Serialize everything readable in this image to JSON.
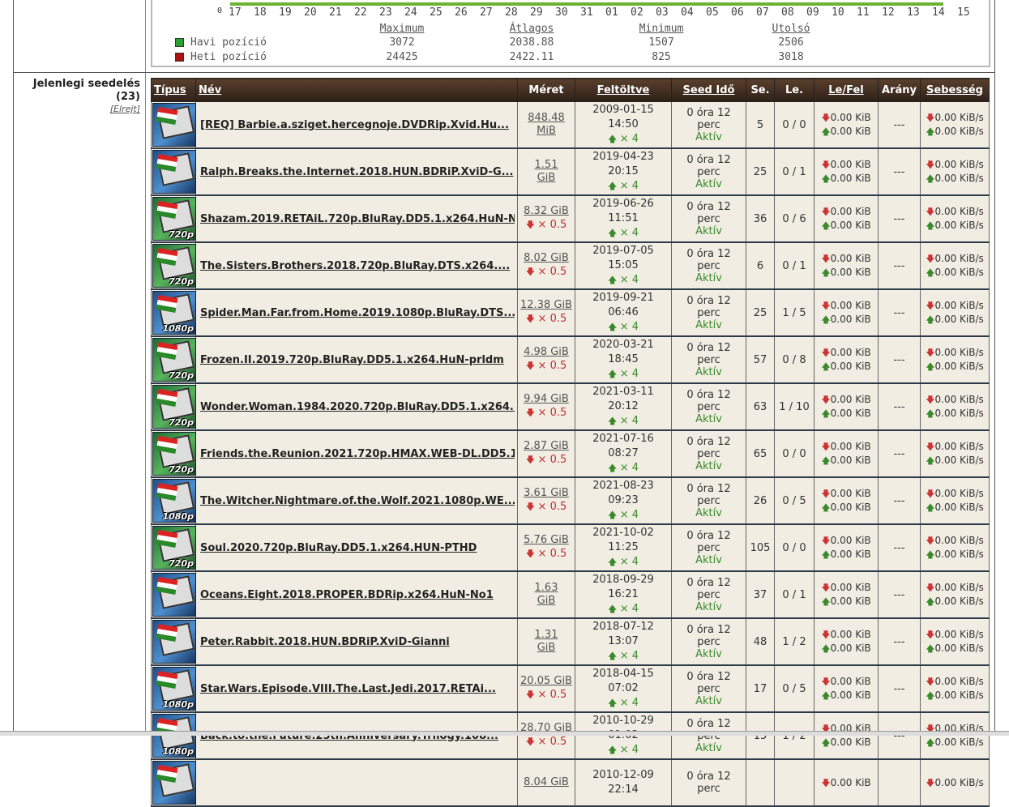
{
  "stats": {
    "axis_zero": "0",
    "axis_labels": [
      "17",
      "18",
      "19",
      "20",
      "21",
      "22",
      "23",
      "24",
      "25",
      "26",
      "27",
      "28",
      "29",
      "30",
      "31",
      "01",
      "02",
      "03",
      "04",
      "05",
      "06",
      "07",
      "08",
      "09",
      "10",
      "11",
      "12",
      "13",
      "14",
      "15"
    ],
    "headers": [
      "Maximum",
      "Átlagos",
      "Minimum",
      "Utolsó"
    ],
    "rows": [
      {
        "label": "Havi pozíció",
        "color": "#2ca02c",
        "values": [
          "3072",
          "2038.88",
          "1507",
          "2506"
        ]
      },
      {
        "label": "Heti pozíció",
        "color": "#b01010",
        "values": [
          "24425",
          "2422.11",
          "825",
          "3018"
        ]
      }
    ]
  },
  "section": {
    "title": "Jelenlegi seedelés",
    "count": "(23)",
    "hide_link": "[Elrejt]"
  },
  "table": {
    "headers": {
      "type": "Típus",
      "name": "Név",
      "size": "Méret",
      "uploaded": "Feltöltve",
      "seedtime": "Seed Idő",
      "seeders": "Se.",
      "leechers": "Le.",
      "downup": "Le/Fel",
      "ratio": "Arány",
      "speed": "Sebesség"
    },
    "rows": [
      {
        "icon": "sd",
        "res": "",
        "name": "[REQ] Barbie.a.sziget.hercegnoje.DVDRip.Xvid.Hu...",
        "size1": "848.48",
        "size2": "MiB",
        "mult": "",
        "date": "2009-01-15 14:50",
        "up_mult": "× 4",
        "seedtime": "0 óra 12 perc",
        "status": "Aktív",
        "se": "5",
        "le": "0 / 0",
        "down": "0.00 KiB",
        "up": "0.00 KiB",
        "ratio": "---",
        "sdown": "0.00 KiB/s",
        "sup": "0.00 KiB/s"
      },
      {
        "icon": "sd",
        "res": "",
        "name": "Ralph.Breaks.the.Internet.2018.HUN.BDRiP.XviD-G...",
        "size1": "1.51",
        "size2": "GiB",
        "mult": "",
        "date": "2019-04-23 20:15",
        "up_mult": "× 4",
        "seedtime": "0 óra 12 perc",
        "status": "Aktív",
        "se": "25",
        "le": "0 / 1",
        "down": "0.00 KiB",
        "up": "0.00 KiB",
        "ratio": "---",
        "sdown": "0.00 KiB/s",
        "sup": "0.00 KiB/s"
      },
      {
        "icon": "hd720",
        "res": "720p",
        "name": "Shazam.2019.RETAiL.720p.BluRay.DD5.1.x264.HuN-No1",
        "size1": "8.32 GiB",
        "size2": "",
        "mult": "× 0.5",
        "date": "2019-06-26 11:51",
        "up_mult": "× 4",
        "seedtime": "0 óra 12 perc",
        "status": "Aktív",
        "se": "36",
        "le": "0 / 6",
        "down": "0.00 KiB",
        "up": "0.00 KiB",
        "ratio": "---",
        "sdown": "0.00 KiB/s",
        "sup": "0.00 KiB/s"
      },
      {
        "icon": "hd720",
        "res": "720p",
        "name": "The.Sisters.Brothers.2018.720p.BluRay.DTS.x264....",
        "size1": "8.02 GiB",
        "size2": "",
        "mult": "× 0.5",
        "date": "2019-07-05 15:05",
        "up_mult": "× 4",
        "seedtime": "0 óra 12 perc",
        "status": "Aktív",
        "se": "6",
        "le": "0 / 1",
        "down": "0.00 KiB",
        "up": "0.00 KiB",
        "ratio": "---",
        "sdown": "0.00 KiB/s",
        "sup": "0.00 KiB/s"
      },
      {
        "icon": "hd1080",
        "res": "1080p",
        "name": "Spider.Man.Far.from.Home.2019.1080p.BluRay.DTS....",
        "size1": "12.38 GiB",
        "size2": "",
        "mult": "× 0.5",
        "date": "2019-09-21 06:46",
        "up_mult": "× 4",
        "seedtime": "0 óra 12 perc",
        "status": "Aktív",
        "se": "25",
        "le": "1 / 5",
        "down": "0.00 KiB",
        "up": "0.00 KiB",
        "ratio": "---",
        "sdown": "0.00 KiB/s",
        "sup": "0.00 KiB/s"
      },
      {
        "icon": "hd720",
        "res": "720p",
        "name": "Frozen.II.2019.720p.BluRay.DD5.1.x264.HuN-prldm",
        "size1": "4.98 GiB",
        "size2": "",
        "mult": "× 0.5",
        "date": "2020-03-21 18:45",
        "up_mult": "× 4",
        "seedtime": "0 óra 12 perc",
        "status": "Aktív",
        "se": "57",
        "le": "0 / 8",
        "down": "0.00 KiB",
        "up": "0.00 KiB",
        "ratio": "---",
        "sdown": "0.00 KiB/s",
        "sup": "0.00 KiB/s"
      },
      {
        "icon": "hd720",
        "res": "720p",
        "name": "Wonder.Woman.1984.2020.720p.BluRay.DD5.1.x264.H...",
        "size1": "9.94 GiB",
        "size2": "",
        "mult": "× 0.5",
        "date": "2021-03-11 20:12",
        "up_mult": "× 4",
        "seedtime": "0 óra 12 perc",
        "status": "Aktív",
        "se": "63",
        "le": "1 / 10",
        "down": "0.00 KiB",
        "up": "0.00 KiB",
        "ratio": "---",
        "sdown": "0.00 KiB/s",
        "sup": "0.00 KiB/s"
      },
      {
        "icon": "hd720",
        "res": "720p",
        "name": "Friends.the.Reunion.2021.720p.HMAX.WEB-DL.DD5.1...",
        "size1": "2.87 GiB",
        "size2": "",
        "mult": "× 0.5",
        "date": "2021-07-16 08:27",
        "up_mult": "× 4",
        "seedtime": "0 óra 12 perc",
        "status": "Aktív",
        "se": "65",
        "le": "0 / 0",
        "down": "0.00 KiB",
        "up": "0.00 KiB",
        "ratio": "---",
        "sdown": "0.00 KiB/s",
        "sup": "0.00 KiB/s"
      },
      {
        "icon": "hd1080",
        "res": "1080p",
        "name": "The.Witcher.Nightmare.of.the.Wolf.2021.1080p.WE...",
        "size1": "3.61 GiB",
        "size2": "",
        "mult": "× 0.5",
        "date": "2021-08-23 09:23",
        "up_mult": "× 4",
        "seedtime": "0 óra 12 perc",
        "status": "Aktív",
        "se": "26",
        "le": "0 / 5",
        "down": "0.00 KiB",
        "up": "0.00 KiB",
        "ratio": "---",
        "sdown": "0.00 KiB/s",
        "sup": "0.00 KiB/s"
      },
      {
        "icon": "hd720",
        "res": "720p",
        "name": "Soul.2020.720p.BluRay.DD5.1.x264.HUN-PTHD",
        "size1": "5.76 GiB",
        "size2": "",
        "mult": "× 0.5",
        "date": "2021-10-02 11:25",
        "up_mult": "× 4",
        "seedtime": "0 óra 12 perc",
        "status": "Aktív",
        "se": "105",
        "le": "0 / 0",
        "down": "0.00 KiB",
        "up": "0.00 KiB",
        "ratio": "---",
        "sdown": "0.00 KiB/s",
        "sup": "0.00 KiB/s"
      },
      {
        "icon": "sd",
        "res": "",
        "name": "Oceans.Eight.2018.PROPER.BDRip.x264.HuN-No1",
        "size1": "1.63",
        "size2": "GiB",
        "mult": "",
        "date": "2018-09-29 16:21",
        "up_mult": "× 4",
        "seedtime": "0 óra 12 perc",
        "status": "Aktív",
        "se": "37",
        "le": "0 / 1",
        "down": "0.00 KiB",
        "up": "0.00 KiB",
        "ratio": "---",
        "sdown": "0.00 KiB/s",
        "sup": "0.00 KiB/s"
      },
      {
        "icon": "sd",
        "res": "",
        "name": "Peter.Rabbit.2018.HUN.BDRiP.XviD-Gianni",
        "size1": "1.31",
        "size2": "GiB",
        "mult": "",
        "date": "2018-07-12 13:07",
        "up_mult": "× 4",
        "seedtime": "0 óra 12 perc",
        "status": "Aktív",
        "se": "48",
        "le": "1 / 2",
        "down": "0.00 KiB",
        "up": "0.00 KiB",
        "ratio": "---",
        "sdown": "0.00 KiB/s",
        "sup": "0.00 KiB/s"
      },
      {
        "icon": "hd1080",
        "res": "1080p",
        "name": "Star.Wars.Episode.VIII.The.Last.Jedi.2017.RETAi...",
        "size1": "20.05 GiB",
        "size2": "",
        "mult": "× 0.5",
        "date": "2018-04-15 07:02",
        "up_mult": "× 4",
        "seedtime": "0 óra 12 perc",
        "status": "Aktív",
        "se": "17",
        "le": "0 / 5",
        "down": "0.00 KiB",
        "up": "0.00 KiB",
        "ratio": "---",
        "sdown": "0.00 KiB/s",
        "sup": "0.00 KiB/s"
      },
      {
        "icon": "hd1080",
        "res": "1080p",
        "name": "Back.to.the.Future.25th.Anniversary.Trilogy.108...",
        "size1": "28.70 GiB",
        "size2": "",
        "mult": "× 0.5",
        "date": "2010-10-29 01:02",
        "up_mult": "× 4",
        "seedtime": "0 óra 12 perc",
        "status": "Aktív",
        "se": "15",
        "le": "1 / 2",
        "down": "0.00 KiB",
        "up": "0.00 KiB",
        "ratio": "---",
        "sdown": "0.00 KiB/s",
        "sup": "0.00 KiB/s"
      },
      {
        "icon": "sd",
        "res": "",
        "name": "",
        "size1": "8.04 GiB",
        "size2": "",
        "mult": "",
        "date": "2010-12-09 22:14",
        "up_mult": "",
        "seedtime": "0 óra 12 perc",
        "status": "",
        "se": "",
        "le": "",
        "down": "0.00 KiB",
        "up": "",
        "ratio": "",
        "sdown": "0.00 KiB/s",
        "sup": ""
      }
    ]
  }
}
